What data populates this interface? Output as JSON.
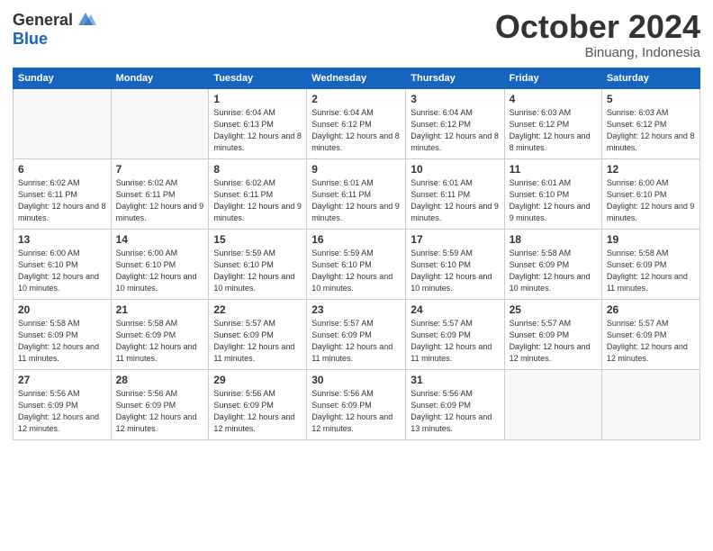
{
  "logo": {
    "general": "General",
    "blue": "Blue"
  },
  "header": {
    "month": "October 2024",
    "location": "Binuang, Indonesia"
  },
  "weekdays": [
    "Sunday",
    "Monday",
    "Tuesday",
    "Wednesday",
    "Thursday",
    "Friday",
    "Saturday"
  ],
  "weeks": [
    [
      {
        "day": "",
        "info": ""
      },
      {
        "day": "",
        "info": ""
      },
      {
        "day": "1",
        "info": "Sunrise: 6:04 AM\nSunset: 6:13 PM\nDaylight: 12 hours and 8 minutes."
      },
      {
        "day": "2",
        "info": "Sunrise: 6:04 AM\nSunset: 6:12 PM\nDaylight: 12 hours and 8 minutes."
      },
      {
        "day": "3",
        "info": "Sunrise: 6:04 AM\nSunset: 6:12 PM\nDaylight: 12 hours and 8 minutes."
      },
      {
        "day": "4",
        "info": "Sunrise: 6:03 AM\nSunset: 6:12 PM\nDaylight: 12 hours and 8 minutes."
      },
      {
        "day": "5",
        "info": "Sunrise: 6:03 AM\nSunset: 6:12 PM\nDaylight: 12 hours and 8 minutes."
      }
    ],
    [
      {
        "day": "6",
        "info": "Sunrise: 6:02 AM\nSunset: 6:11 PM\nDaylight: 12 hours and 8 minutes."
      },
      {
        "day": "7",
        "info": "Sunrise: 6:02 AM\nSunset: 6:11 PM\nDaylight: 12 hours and 9 minutes."
      },
      {
        "day": "8",
        "info": "Sunrise: 6:02 AM\nSunset: 6:11 PM\nDaylight: 12 hours and 9 minutes."
      },
      {
        "day": "9",
        "info": "Sunrise: 6:01 AM\nSunset: 6:11 PM\nDaylight: 12 hours and 9 minutes."
      },
      {
        "day": "10",
        "info": "Sunrise: 6:01 AM\nSunset: 6:11 PM\nDaylight: 12 hours and 9 minutes."
      },
      {
        "day": "11",
        "info": "Sunrise: 6:01 AM\nSunset: 6:10 PM\nDaylight: 12 hours and 9 minutes."
      },
      {
        "day": "12",
        "info": "Sunrise: 6:00 AM\nSunset: 6:10 PM\nDaylight: 12 hours and 9 minutes."
      }
    ],
    [
      {
        "day": "13",
        "info": "Sunrise: 6:00 AM\nSunset: 6:10 PM\nDaylight: 12 hours and 10 minutes."
      },
      {
        "day": "14",
        "info": "Sunrise: 6:00 AM\nSunset: 6:10 PM\nDaylight: 12 hours and 10 minutes."
      },
      {
        "day": "15",
        "info": "Sunrise: 5:59 AM\nSunset: 6:10 PM\nDaylight: 12 hours and 10 minutes."
      },
      {
        "day": "16",
        "info": "Sunrise: 5:59 AM\nSunset: 6:10 PM\nDaylight: 12 hours and 10 minutes."
      },
      {
        "day": "17",
        "info": "Sunrise: 5:59 AM\nSunset: 6:10 PM\nDaylight: 12 hours and 10 minutes."
      },
      {
        "day": "18",
        "info": "Sunrise: 5:58 AM\nSunset: 6:09 PM\nDaylight: 12 hours and 10 minutes."
      },
      {
        "day": "19",
        "info": "Sunrise: 5:58 AM\nSunset: 6:09 PM\nDaylight: 12 hours and 11 minutes."
      }
    ],
    [
      {
        "day": "20",
        "info": "Sunrise: 5:58 AM\nSunset: 6:09 PM\nDaylight: 12 hours and 11 minutes."
      },
      {
        "day": "21",
        "info": "Sunrise: 5:58 AM\nSunset: 6:09 PM\nDaylight: 12 hours and 11 minutes."
      },
      {
        "day": "22",
        "info": "Sunrise: 5:57 AM\nSunset: 6:09 PM\nDaylight: 12 hours and 11 minutes."
      },
      {
        "day": "23",
        "info": "Sunrise: 5:57 AM\nSunset: 6:09 PM\nDaylight: 12 hours and 11 minutes."
      },
      {
        "day": "24",
        "info": "Sunrise: 5:57 AM\nSunset: 6:09 PM\nDaylight: 12 hours and 11 minutes."
      },
      {
        "day": "25",
        "info": "Sunrise: 5:57 AM\nSunset: 6:09 PM\nDaylight: 12 hours and 12 minutes."
      },
      {
        "day": "26",
        "info": "Sunrise: 5:57 AM\nSunset: 6:09 PM\nDaylight: 12 hours and 12 minutes."
      }
    ],
    [
      {
        "day": "27",
        "info": "Sunrise: 5:56 AM\nSunset: 6:09 PM\nDaylight: 12 hours and 12 minutes."
      },
      {
        "day": "28",
        "info": "Sunrise: 5:56 AM\nSunset: 6:09 PM\nDaylight: 12 hours and 12 minutes."
      },
      {
        "day": "29",
        "info": "Sunrise: 5:56 AM\nSunset: 6:09 PM\nDaylight: 12 hours and 12 minutes."
      },
      {
        "day": "30",
        "info": "Sunrise: 5:56 AM\nSunset: 6:09 PM\nDaylight: 12 hours and 12 minutes."
      },
      {
        "day": "31",
        "info": "Sunrise: 5:56 AM\nSunset: 6:09 PM\nDaylight: 12 hours and 13 minutes."
      },
      {
        "day": "",
        "info": ""
      },
      {
        "day": "",
        "info": ""
      }
    ]
  ]
}
